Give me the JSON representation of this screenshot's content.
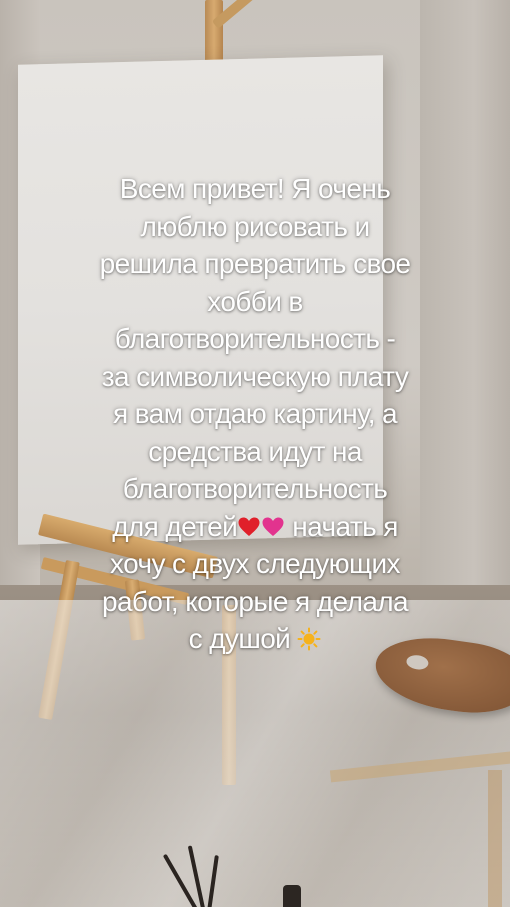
{
  "story": {
    "lines": [
      "Всем привет! Я очень",
      "люблю рисовать и",
      "решила превратить свое",
      "хобби в",
      "благотворительность -",
      "за символическую плату",
      "я вам отдаю картину, а",
      "средства идут на",
      "благотворительность",
      "для детей",
      " начать я",
      "хочу с двух следующих",
      "работ, которые я делала",
      "с душой"
    ],
    "emojis": {
      "red_heart": "red-heart-icon",
      "pink_heart": "pink-heart-icon",
      "sun": "sun-icon"
    },
    "colors": {
      "text": "#ffffff",
      "red_heart": "#e0202a",
      "pink_heart": "#e2338e",
      "sun": "#f6b21b"
    }
  }
}
